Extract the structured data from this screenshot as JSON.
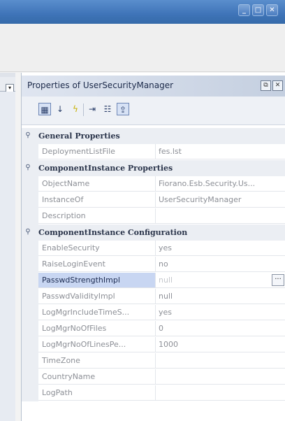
{
  "panel": {
    "title": "Properties of UserSecurityManager",
    "restore_glyph": "⧉",
    "close_glyph": "✕"
  },
  "toolbar": {
    "categorized_icon": "▦",
    "sort_icon": "↓",
    "bolt_icon": "ϟ",
    "pin_icon": "⇥",
    "description_icon": "☷",
    "export_icon": "⇪"
  },
  "categories": {
    "general": "General Properties",
    "instance_props": "ComponentInstance Properties",
    "instance_config": "ComponentInstance Configuration"
  },
  "properties": {
    "deployment_list_file": {
      "name": "DeploymentListFile",
      "value": "fes.lst"
    },
    "object_name": {
      "name": "ObjectName",
      "value": "Fiorano.Esb.Security.Us..."
    },
    "instance_of": {
      "name": "InstanceOf",
      "value": "UserSecurityManager"
    },
    "description": {
      "name": "Description",
      "value": ""
    },
    "enable_security": {
      "name": "EnableSecurity",
      "value": "yes"
    },
    "raise_login_event": {
      "name": "RaiseLoginEvent",
      "value": "no"
    },
    "passwd_strength_impl": {
      "name": "PasswdStrengthImpl",
      "value": "null"
    },
    "passwd_validity_impl": {
      "name": "PasswdValidityImpl",
      "value": "null"
    },
    "log_mgr_include_time": {
      "name": "LogMgrIncludeTimeS...",
      "value": "yes"
    },
    "log_mgr_no_of_files": {
      "name": "LogMgrNoOfFiles",
      "value": "0"
    },
    "log_mgr_no_of_lines": {
      "name": "LogMgrNoOfLinesPe...",
      "value": "1000"
    },
    "time_zone": {
      "name": "TimeZone",
      "value": ""
    },
    "country_name": {
      "name": "CountryName",
      "value": ""
    },
    "log_path": {
      "name": "LogPath",
      "value": ""
    }
  },
  "colors": {
    "title_bar": "#3f74b8",
    "selected_row": "#c8d6f2"
  }
}
